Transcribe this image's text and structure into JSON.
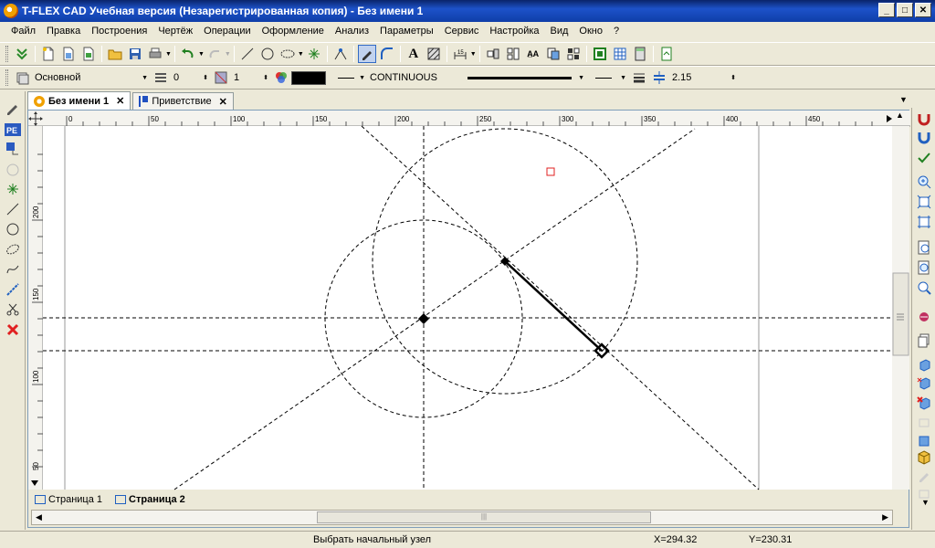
{
  "window": {
    "title": "T-FLEX CAD Учебная версия (Незарегистрированная копия) - Без имени 1"
  },
  "menu": [
    "Файл",
    "Правка",
    "Построения",
    "Чертёж",
    "Операции",
    "Оформление",
    "Анализ",
    "Параметры",
    "Сервис",
    "Настройка",
    "Вид",
    "Окно",
    "?"
  ],
  "props": {
    "layer": "Основной",
    "level": "0",
    "priority": "1",
    "linetype": "CONTINUOUS",
    "width": "2.15"
  },
  "tabs": [
    {
      "label": "Без имени 1",
      "active": true
    },
    {
      "label": "Приветствие",
      "active": false
    }
  ],
  "ruler": {
    "h_ticks": [
      "0",
      "50",
      "100",
      "150",
      "200",
      "250",
      "300",
      "350",
      "400",
      "450"
    ],
    "v_ticks": [
      "200",
      "150",
      "100",
      "50"
    ]
  },
  "pages": [
    {
      "label": "Страница 1",
      "active": false
    },
    {
      "label": "Страница 2",
      "active": true
    }
  ],
  "status": {
    "prompt": "Выбрать начальный узел",
    "x": "X=294.32",
    "y": "Y=230.31"
  },
  "colors": {
    "title": "#0a246a",
    "marker": "#e02020",
    "delete": "#e02020"
  }
}
